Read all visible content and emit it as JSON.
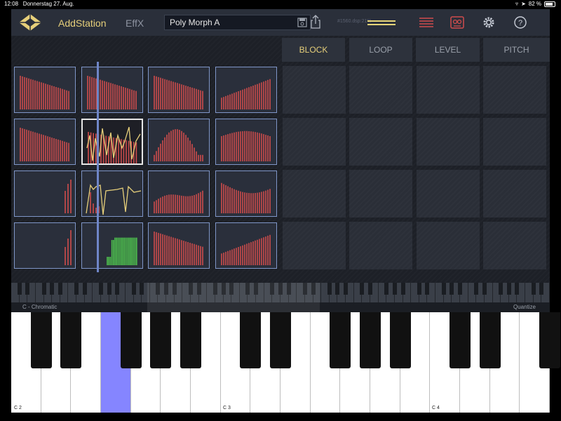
{
  "status": {
    "time": "12:08",
    "date": "Donnerstag 27. Aug.",
    "battery": "82 %",
    "battery_level": 0.82
  },
  "toolbar": {
    "app_title": "AddStation",
    "effx_label": "EffX",
    "preset_name": "Poly Morph A",
    "dsp_readout": "#1560.dsp:21%"
  },
  "tabs": [
    "BLOCK",
    "LOOP",
    "LEVEL",
    "PITCH"
  ],
  "pads": [
    [
      "decay",
      "decay",
      "decay",
      "rise"
    ],
    [
      "decay",
      "yellow_wave",
      "hump",
      "plateau"
    ],
    [
      "right_stub",
      "yellow_wave2",
      "rise_wave",
      "dip"
    ],
    [
      "right_stub2",
      "green_block",
      "decay",
      "rise"
    ]
  ],
  "keyboard": {
    "scale_label": "C - Chromatic",
    "quantize_label": "Quantize",
    "octave_labels": [
      "C 2",
      "C 3",
      "C 4"
    ],
    "highlighted_key": "F 2"
  },
  "colors": {
    "accent_yellow": "#e6cf7a",
    "bar_red": "#cf4c4c",
    "bar_green": "#4ec24e",
    "pad_border": "#7f96c8",
    "highlight_key": "#8585ff"
  },
  "icons": [
    "app-logo-icon",
    "save-icon",
    "share-icon",
    "list-icon",
    "tape-icon",
    "gear-icon",
    "help-icon"
  ]
}
